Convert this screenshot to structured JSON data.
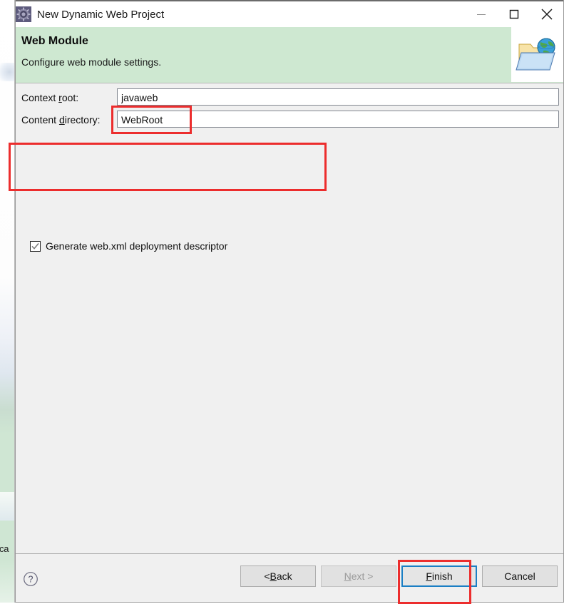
{
  "window": {
    "title": "New Dynamic Web Project",
    "icon": "eclipse-wizard-icon",
    "minimize_label": "Minimize",
    "maximize_label": "Maximize",
    "close_label": "Close"
  },
  "header": {
    "title": "Web Module",
    "subtitle": "Configure web module settings.",
    "icon": "web-folder-globe-icon",
    "background_color": "#cee8d1"
  },
  "form": {
    "context_root": {
      "label_before": "Context ",
      "label_mnemonic": "r",
      "label_after": "oot:",
      "value": "javaweb",
      "placeholder": ""
    },
    "content_directory": {
      "label_before": "Content ",
      "label_mnemonic": "d",
      "label_after": "irectory:",
      "value": "WebRoot",
      "placeholder": ""
    },
    "generate_webxml": {
      "label": "Generate web.xml deployment descriptor",
      "checked": true,
      "check_glyph": "check-icon"
    }
  },
  "annotations": {
    "color": "#ec2d2d",
    "boxes": [
      {
        "name": "content-directory-highlight"
      },
      {
        "name": "generate-webxml-highlight"
      },
      {
        "name": "finish-button-highlight"
      }
    ]
  },
  "footer": {
    "help_icon": "question-mark-icon",
    "buttons": [
      {
        "name": "back-button",
        "prefix": "< ",
        "mnemonic": "B",
        "suffix": "ack",
        "state": "enabled"
      },
      {
        "name": "next-button",
        "prefix": "",
        "mnemonic": "N",
        "suffix": "ext >",
        "state": "disabled"
      },
      {
        "name": "finish-button",
        "prefix": "",
        "mnemonic": "F",
        "suffix": "inish",
        "state": "focused"
      },
      {
        "name": "cancel-button",
        "prefix": "",
        "mnemonic": "",
        "suffix": "Cancel",
        "state": "enabled"
      }
    ]
  },
  "background": {
    "partial_text": "ca"
  }
}
